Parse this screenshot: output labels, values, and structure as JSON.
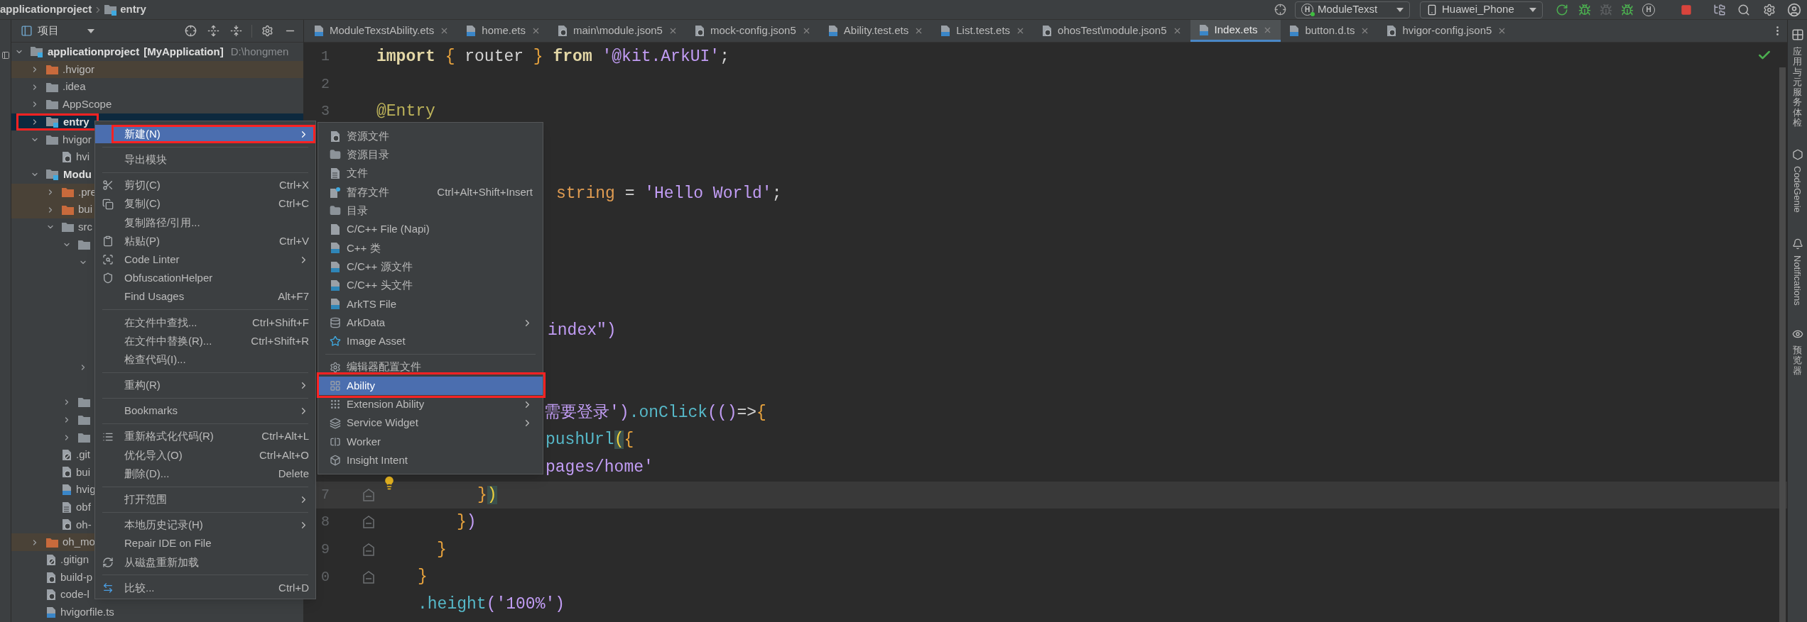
{
  "breadcrumb": [
    {
      "label": "applicationproject",
      "kind": "plain"
    },
    {
      "label": "entry",
      "kind": "module"
    }
  ],
  "toolbar": {
    "run_config": {
      "glyph": "H",
      "label": "ModuleTexst"
    },
    "device": "Huawei_Phone",
    "profiler_glyph": "H"
  },
  "project_panel": {
    "title": "项目"
  },
  "tree": [
    {
      "label": "applicationproject",
      "tag": "[MyApplication]",
      "path": "D:\\hongmen",
      "kind": "module",
      "expanded": true,
      "selected": false,
      "excluded": false,
      "children": [
        {
          "label": ".hvigor",
          "kind": "folder",
          "expanded": false,
          "selected": false,
          "excluded": true
        },
        {
          "label": ".idea",
          "kind": "folder",
          "expanded": false,
          "selected": false,
          "excluded": false
        },
        {
          "label": "AppScope",
          "kind": "folder",
          "expanded": false,
          "selected": false,
          "excluded": false
        },
        {
          "label": "entry",
          "kind": "module",
          "expanded": false,
          "selected": true,
          "excluded": false,
          "framed": true
        },
        {
          "label": "hvigor",
          "kind": "folder",
          "expanded": true,
          "selected": false,
          "excluded": false,
          "children": [
            {
              "label": "hvi",
              "kind": "json",
              "selected": false,
              "excluded": false
            }
          ]
        },
        {
          "label": "Modu",
          "kind": "module",
          "expanded": true,
          "selected": false,
          "excluded": false,
          "children": [
            {
              "label": ".pre",
              "kind": "folder",
              "expanded": false,
              "selected": false,
              "excluded": true
            },
            {
              "label": "bui",
              "kind": "folder",
              "expanded": false,
              "selected": false,
              "excluded": true
            },
            {
              "label": "src",
              "kind": "folder",
              "expanded": true,
              "selected": false,
              "excluded": false,
              "children": [
                {
                  "kind": "folder",
                  "expanded": true,
                  "selected": false,
                  "excluded": false,
                  "children": [
                    {
                      "expanded": true,
                      "selected": false
                    },
                    {
                      "expanded": false,
                      "selected": false
                    }
                  ]
                },
                {
                  "kind": "folder",
                  "expanded": false,
                  "selected": false,
                  "excluded": false
                },
                {
                  "kind": "folder",
                  "expanded": false,
                  "selected": false,
                  "excluded": false
                },
                {
                  "kind": "folder",
                  "expanded": false,
                  "selected": false,
                  "excluded": false
                }
              ]
            },
            {
              "label": ".git",
              "kind": "git",
              "selected": false,
              "excluded": false
            },
            {
              "label": "bui",
              "kind": "json",
              "selected": false,
              "excluded": false
            },
            {
              "label": "hvig",
              "kind": "ts",
              "selected": false,
              "excluded": false
            },
            {
              "label": "obf",
              "kind": "text",
              "selected": false,
              "excluded": false
            },
            {
              "label": "oh-",
              "kind": "json",
              "selected": false,
              "excluded": false
            }
          ]
        },
        {
          "label": "oh_mo",
          "kind": "folder",
          "expanded": false,
          "selected": false,
          "excluded": true
        },
        {
          "label": ".gitign",
          "kind": "git",
          "selected": false,
          "excluded": false
        },
        {
          "label": "build-p",
          "kind": "json",
          "selected": false,
          "excluded": false
        },
        {
          "label": "code-l",
          "kind": "json",
          "selected": false,
          "excluded": false
        },
        {
          "label": "hvigorfile.ts",
          "kind": "ts",
          "selected": false,
          "excluded": false
        }
      ]
    }
  ],
  "tabs": [
    {
      "label": "ModuleTexstAbility.ets",
      "kind": "ets",
      "selected": false
    },
    {
      "label": "home.ets",
      "kind": "ets",
      "selected": false
    },
    {
      "label": "main\\module.json5",
      "kind": "json",
      "selected": false
    },
    {
      "label": "mock-config.json5",
      "kind": "json",
      "selected": false
    },
    {
      "label": "Ability.test.ets",
      "kind": "ets",
      "selected": false
    },
    {
      "label": "List.test.ets",
      "kind": "ets",
      "selected": false
    },
    {
      "label": "ohosTest\\module.json5",
      "kind": "json",
      "selected": false
    },
    {
      "label": "Index.ets",
      "kind": "ets",
      "selected": true
    },
    {
      "label": "button.d.ts",
      "kind": "ts",
      "selected": false
    },
    {
      "label": "hvigor-config.json5",
      "kind": "json",
      "selected": false
    }
  ],
  "editor": {
    "lines": [
      {
        "number": "1",
        "tokens": [
          {
            "text": "import",
            "kind": "keyword"
          },
          {
            "text": "{",
            "kind": "brace",
            "gap": true
          },
          {
            "text": "router",
            "kind": "plain",
            "gap": true
          },
          {
            "text": "}",
            "kind": "brace",
            "gap": true
          },
          {
            "text": "from",
            "kind": "keyword",
            "gap": true
          },
          {
            "text": "'@kit.ArkUI'",
            "kind": "string",
            "gap": true
          },
          {
            "text": ";",
            "kind": "plain"
          }
        ]
      },
      {
        "number": "2"
      },
      {
        "number": "3",
        "tokens": [
          {
            "text": "@Entry",
            "kind": "decorator"
          }
        ]
      },
      {
        "tokens": [
          {
            "text": "string",
            "kind": "type"
          },
          {
            "text": "=",
            "kind": "plain",
            "gap": true
          },
          {
            "text": "'Hello World'",
            "kind": "string",
            "gap": true
          },
          {
            "text": ";",
            "kind": "plain"
          }
        ]
      },
      {
        "tokens": [
          {
            "text": "index\"",
            "kind": "string"
          },
          {
            "text": ")",
            "kind": "paren"
          }
        ]
      },
      {
        "tokens": [
          {
            "text": "需要登录'",
            "kind": "string"
          },
          {
            "text": ")",
            "kind": "paren"
          },
          {
            "text": ".onClick",
            "kind": "method"
          },
          {
            "text": "(()",
            "kind": "paren"
          },
          {
            "text": "=>",
            "kind": "plain"
          },
          {
            "text": "{",
            "kind": "brace"
          }
        ]
      },
      {
        "tokens": [
          {
            "text": "pushUrl",
            "kind": "method"
          },
          {
            "text": "(",
            "kind": "match"
          },
          {
            "text": "{",
            "kind": "brace"
          }
        ]
      },
      {
        "tokens": [
          {
            "text": "pages/home'",
            "kind": "string"
          }
        ]
      },
      {
        "number": "7",
        "current": true,
        "hint": true,
        "fold": true,
        "tokens": [
          {
            "text": "}",
            "kind": "brace"
          },
          {
            "text": ")",
            "kind": "match"
          }
        ]
      },
      {
        "number": "8",
        "fold": true,
        "tokens": [
          {
            "text": "}",
            "kind": "brace"
          },
          {
            "text": ")",
            "kind": "paren"
          }
        ]
      },
      {
        "number": "9",
        "fold": true,
        "tokens": [
          {
            "text": "}",
            "kind": "brace"
          }
        ]
      },
      {
        "number": "0",
        "fold": true,
        "tokens": [
          {
            "text": "}",
            "kind": "brace"
          }
        ]
      },
      {
        "tokens": [
          {
            "text": ".height",
            "kind": "method"
          },
          {
            "text": "(",
            "kind": "paren"
          },
          {
            "text": "'100%'",
            "kind": "string"
          },
          {
            "text": ")",
            "kind": "paren"
          }
        ]
      }
    ]
  },
  "context_menu": {
    "items": [
      {
        "kind": "item",
        "label": "新建(N)",
        "submenu": true,
        "selected": true,
        "framed": true
      },
      {
        "kind": "separator"
      },
      {
        "kind": "item",
        "label": "导出模块",
        "selected": false
      },
      {
        "kind": "separator"
      },
      {
        "kind": "item",
        "label": "剪切(C)",
        "shortcut": "Ctrl+X",
        "selected": false
      },
      {
        "kind": "item",
        "label": "复制(C)",
        "shortcut": "Ctrl+C",
        "selected": false
      },
      {
        "kind": "item",
        "label": "复制路径/引用...",
        "selected": false
      },
      {
        "kind": "item",
        "label": "粘贴(P)",
        "shortcut": "Ctrl+V",
        "selected": false
      },
      {
        "kind": "item",
        "label": "Code Linter",
        "submenu": true,
        "selected": false
      },
      {
        "kind": "item",
        "label": "ObfuscationHelper",
        "selected": false
      },
      {
        "kind": "item",
        "label": "Find Usages",
        "shortcut": "Alt+F7",
        "selected": false
      },
      {
        "kind": "separator"
      },
      {
        "kind": "item",
        "label": "在文件中查找...",
        "shortcut": "Ctrl+Shift+F",
        "selected": false
      },
      {
        "kind": "item",
        "label": "在文件中替换(R)...",
        "shortcut": "Ctrl+Shift+R",
        "selected": false
      },
      {
        "kind": "item",
        "label": "检查代码(I)...",
        "selected": false
      },
      {
        "kind": "separator"
      },
      {
        "kind": "item",
        "label": "重构(R)",
        "submenu": true,
        "selected": false
      },
      {
        "kind": "separator"
      },
      {
        "kind": "item",
        "label": "Bookmarks",
        "submenu": true,
        "selected": false
      },
      {
        "kind": "separator"
      },
      {
        "kind": "item",
        "label": "重新格式化代码(R)",
        "shortcut": "Ctrl+Alt+L",
        "selected": false
      },
      {
        "kind": "item",
        "label": "优化导入(O)",
        "shortcut": "Ctrl+Alt+O",
        "selected": false
      },
      {
        "kind": "item",
        "label": "删除(D)...",
        "shortcut": "Delete",
        "selected": false
      },
      {
        "kind": "separator"
      },
      {
        "kind": "item",
        "label": "打开范围",
        "submenu": true,
        "selected": false
      },
      {
        "kind": "separator"
      },
      {
        "kind": "item",
        "label": "本地历史记录(H)",
        "submenu": true,
        "selected": false
      },
      {
        "kind": "item",
        "label": "Repair IDE on File",
        "selected": false
      },
      {
        "kind": "item",
        "label": "从磁盘重新加载",
        "selected": false
      },
      {
        "kind": "separator"
      },
      {
        "kind": "item",
        "label": "比较...",
        "shortcut": "Ctrl+D",
        "selected": false
      }
    ]
  },
  "submenu": {
    "items": [
      {
        "kind": "item",
        "label": "资源文件",
        "selected": false
      },
      {
        "kind": "item",
        "label": "资源目录",
        "selected": false
      },
      {
        "kind": "item",
        "label": "文件",
        "selected": false
      },
      {
        "kind": "item",
        "label": "暂存文件",
        "shortcut": "Ctrl+Alt+Shift+Insert",
        "selected": false
      },
      {
        "kind": "item",
        "label": "目录",
        "selected": false
      },
      {
        "kind": "item",
        "label": "C/C++ File (Napi)",
        "selected": false
      },
      {
        "kind": "item",
        "label": "C++ 类",
        "selected": false
      },
      {
        "kind": "item",
        "label": "C/C++ 源文件",
        "selected": false
      },
      {
        "kind": "item",
        "label": "C/C++ 头文件",
        "selected": false
      },
      {
        "kind": "item",
        "label": "ArkTS File",
        "selected": false
      },
      {
        "kind": "item",
        "label": "ArkData",
        "submenu": true,
        "selected": false
      },
      {
        "kind": "item",
        "label": "Image Asset",
        "selected": false
      },
      {
        "kind": "separator"
      },
      {
        "kind": "item",
        "label": "编辑器配置文件",
        "selected": false
      },
      {
        "kind": "item",
        "label": "Ability",
        "selected": true,
        "framed": true
      },
      {
        "kind": "item",
        "label": "Extension Ability",
        "submenu": true,
        "selected": false
      },
      {
        "kind": "item",
        "label": "Service Widget",
        "submenu": true,
        "selected": false
      },
      {
        "kind": "item",
        "label": "Worker",
        "selected": false
      },
      {
        "kind": "item",
        "label": "Insight Intent",
        "selected": false
      }
    ]
  },
  "right_strip": [
    {
      "label": "应用与元服务体检",
      "kind": "cjk"
    },
    {
      "label": "CodeGenie",
      "kind": "latin"
    },
    {
      "label": "Notifications",
      "kind": "latin"
    },
    {
      "label": "预览器",
      "kind": "cjk"
    }
  ]
}
